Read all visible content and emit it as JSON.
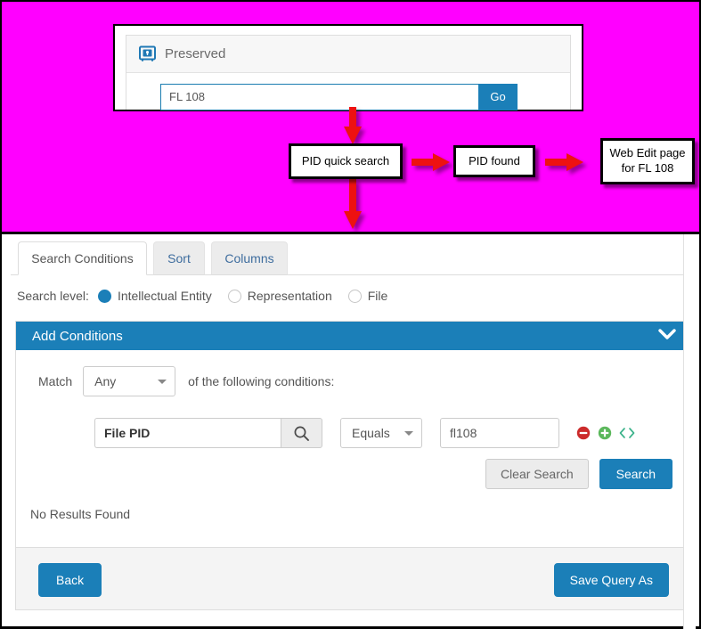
{
  "annotations": {
    "box_pid_search": "PID quick search",
    "box_pid_found": "PID found",
    "box_web_edit": "Web Edit page for FL 108"
  },
  "preserved": {
    "title": "Preserved",
    "icon": "safe-vault-icon",
    "quick_search_value": "FL 108",
    "quick_search_placeholder": "",
    "go_label": "Go"
  },
  "tabs": [
    {
      "label": "Search Conditions",
      "active": true
    },
    {
      "label": "Sort",
      "active": false
    },
    {
      "label": "Columns",
      "active": false
    }
  ],
  "search_level": {
    "label": "Search level:",
    "options": [
      {
        "label": "Intellectual Entity",
        "selected": true
      },
      {
        "label": "Representation",
        "selected": false
      },
      {
        "label": "File",
        "selected": false
      }
    ]
  },
  "add_conditions": {
    "title": "Add Conditions",
    "collapse_icon": "chevron-down-icon",
    "match_label": "Match",
    "match_value": "Any",
    "match_suffix": "of the following conditions:",
    "condition": {
      "field_value": "File PID",
      "field_search_icon": "search-icon",
      "operator_value": "Equals",
      "value": "fl108",
      "value_placeholder": "",
      "remove_icon": "minus-circle-icon",
      "add_icon": "plus-circle-icon",
      "code_icon": "code-brackets-icon"
    },
    "clear_label": "Clear Search",
    "search_label": "Search"
  },
  "results": {
    "message": "No Results Found"
  },
  "footer": {
    "back_label": "Back",
    "save_query_label": "Save Query As"
  },
  "colors": {
    "accent": "#1b7fb8",
    "highlight_background": "#ff00ff",
    "arrow": "#ee1111",
    "remove": "#cc2b2b",
    "add": "#5cb85c",
    "code": "#3cb38b"
  }
}
